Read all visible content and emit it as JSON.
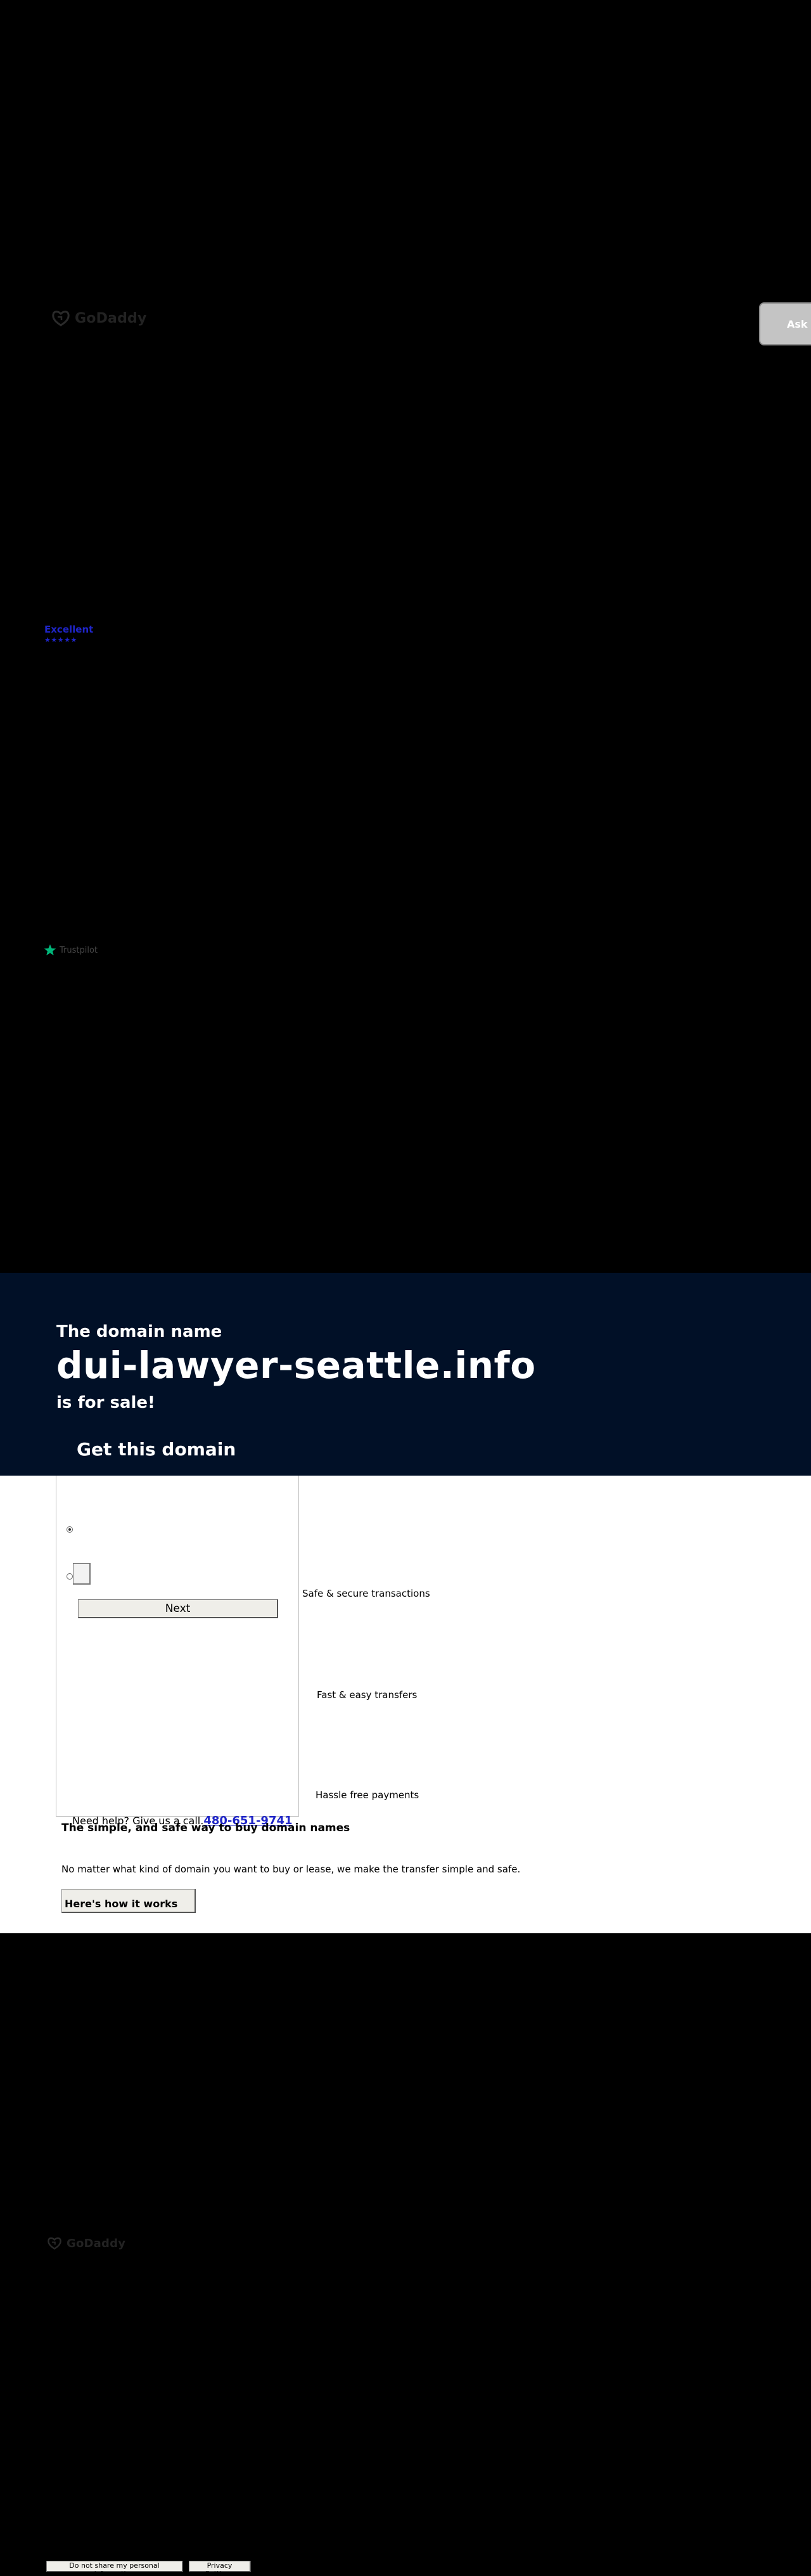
{
  "header": {
    "logo_text": "GoDaddy",
    "ask_button_label": "Ask A"
  },
  "rating": {
    "label": "Excellent",
    "stars": "★★★★★",
    "trustpilot_text": "Trustpilot"
  },
  "hero": {
    "intro": "The domain name",
    "domain": "dui-lawyer-seattle.info",
    "suffix": "is for sale!",
    "cta": "Get this domain"
  },
  "purchase": {
    "next_label": "Next"
  },
  "features": {
    "secure": "Safe & secure transactions",
    "fast": "Fast & easy transfers",
    "hassle": "Hassle free payments"
  },
  "help": {
    "text": "Need help? Give us a call.",
    "phone": "480-651-9741"
  },
  "info": {
    "title": "The simple, and safe way to buy domain names",
    "description": "No matter what kind of domain you want to buy or lease, we make the transfer simple and safe.",
    "button_label": "Here's how it works"
  },
  "footer": {
    "logo_text": "GoDaddy",
    "do_not_share_label": "Do not share my personal information",
    "privacy_label": "Privacy Settings"
  },
  "colors": {
    "hero_bg": "#011027",
    "link_blue": "#1f25c8",
    "trustpilot_green": "#00b67a"
  }
}
